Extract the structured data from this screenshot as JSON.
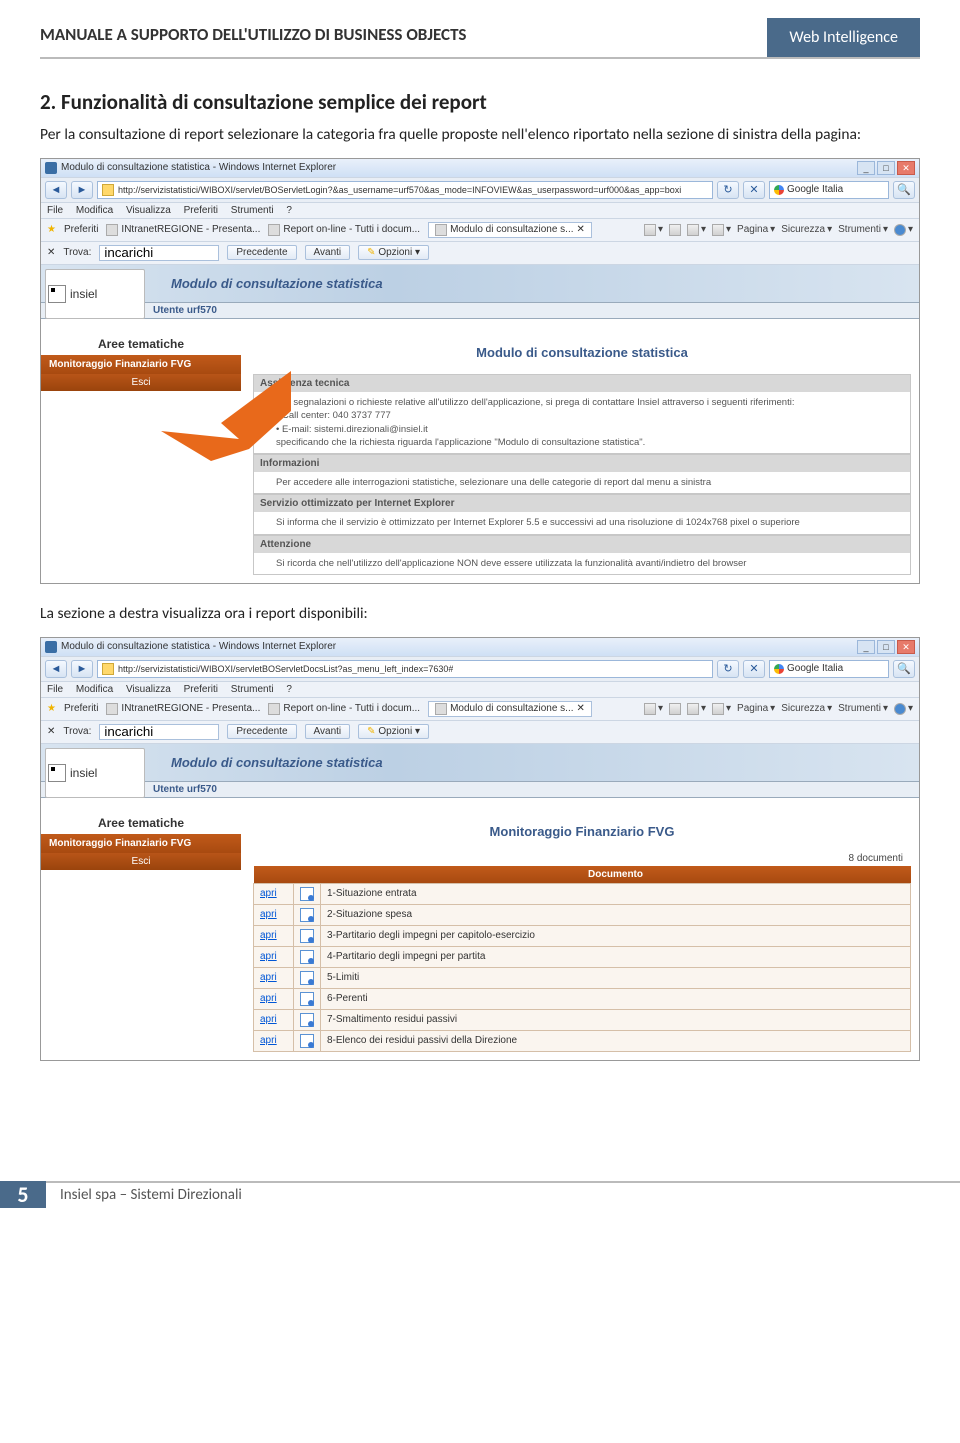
{
  "header": {
    "title": "MANUALE A SUPPORTO DELL'UTILIZZO DI BUSINESS OBJECTS",
    "badge": "Web Intelligence"
  },
  "section": {
    "heading": "2. Funzionalità di consultazione semplice dei report",
    "para1": "Per la consultazione di report selezionare la categoria fra quelle proposte nell'elenco riportato nella sezione di sinistra della pagina:",
    "para2": "La sezione a destra visualizza ora i report disponibili:"
  },
  "ie": {
    "window_title": "Modulo di consultazione statistica - Windows Internet Explorer",
    "url1": "http://servizistatistici/WIBOXI/servlet/BOServletLogin?&as_username=urf570&as_mode=INFOVIEW&as_userpassword=urf000&as_app=boxi",
    "url2": "http://servizistatistici/WIBOXI/servletBOServletDocsList?as_menu_left_index=7630#",
    "search_engine": "Google Italia",
    "menu": {
      "file": "File",
      "modifica": "Modifica",
      "visualizza": "Visualizza",
      "preferiti": "Preferiti",
      "strumenti": "Strumenti",
      "help": "?"
    },
    "fav_label": "Preferiti",
    "fav1": "INtranetREGIONE - Presenta...",
    "fav2": "Report on-line - Tutti i docum...",
    "fav3": "Modulo di consultazione s...",
    "tools": {
      "pagina": "Pagina",
      "sicurezza": "Sicurezza",
      "strumenti": "Strumenti"
    },
    "find_label": "Trova:",
    "find_value": "incarichi",
    "find_precedente": "Precedente",
    "find_avanti": "Avanti",
    "find_opzioni": "Opzioni"
  },
  "app": {
    "banner_title": "Modulo di consultazione statistica",
    "logo": "insiel",
    "user": "Utente urf570",
    "sidebar_title": "Aree tematiche",
    "sidebar_item": "Monitoraggio Finanziario FVG",
    "sidebar_esci": "Esci"
  },
  "shot1": {
    "main_title": "Modulo di consultazione statistica",
    "cards": [
      {
        "head": "Assistenza tecnica",
        "body": "Per segnalazioni o richieste relative all'utilizzo dell'applicazione, si prega di contattare Insiel attraverso i seguenti riferimenti:\n• Call center: 040 3737 777\n• E-mail: sistemi.direzionali@insiel.it\nspecificando che la richiesta riguarda l'applicazione \"Modulo di consultazione statistica\"."
      },
      {
        "head": "Informazioni",
        "body": "Per accedere alle interrogazioni statistiche, selezionare una delle categorie di report dal menu a sinistra"
      },
      {
        "head": "Servizio ottimizzato per Internet Explorer",
        "body": "Si informa che il servizio è ottimizzato per Internet Explorer 5.5 e successivi ad una risoluzione di 1024x768 pixel o superiore"
      },
      {
        "head": "Attenzione",
        "body": "Si ricorda che nell'utilizzo dell'applicazione NON deve essere utilizzata la funzionalità avanti/indietro del browser"
      }
    ]
  },
  "shot2": {
    "main_title": "Monitoraggio Finanziario FVG",
    "doc_count": "8 documenti",
    "col_header": "Documento",
    "open_label": "apri",
    "docs": [
      "1-Situazione entrata",
      "2-Situazione spesa",
      "3-Partitario degli impegni per capitolo-esercizio",
      "4-Partitario degli impegni per partita",
      "5-Limiti",
      "6-Perenti",
      "7-Smaltimento residui passivi",
      "8-Elenco dei residui passivi della Direzione"
    ]
  },
  "footer": {
    "page": "5",
    "text": "Insiel spa – Sistemi Direzionali"
  }
}
